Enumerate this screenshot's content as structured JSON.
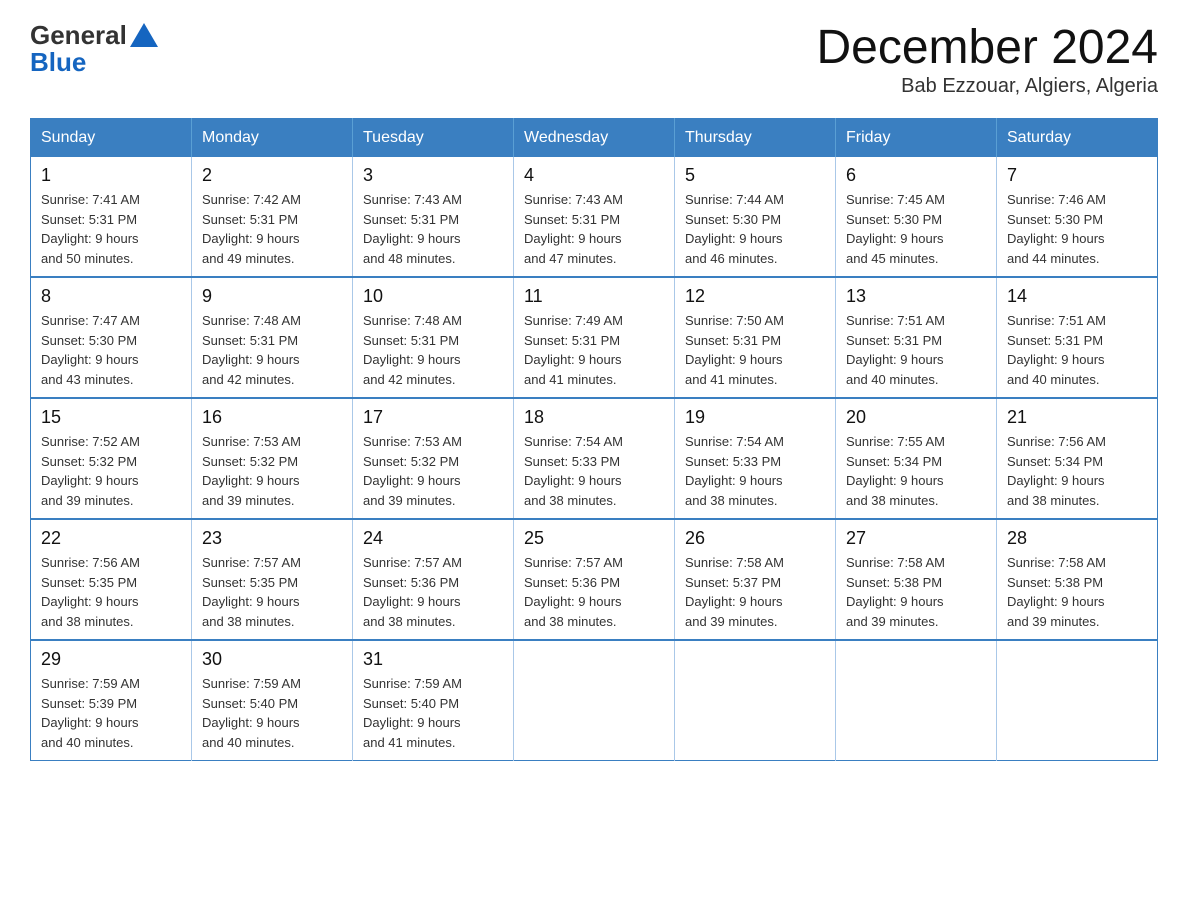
{
  "logo": {
    "general": "General",
    "blue": "Blue"
  },
  "title": "December 2024",
  "subtitle": "Bab Ezzouar, Algiers, Algeria",
  "days_of_week": [
    "Sunday",
    "Monday",
    "Tuesday",
    "Wednesday",
    "Thursday",
    "Friday",
    "Saturday"
  ],
  "weeks": [
    [
      {
        "day": "1",
        "sunrise": "7:41 AM",
        "sunset": "5:31 PM",
        "daylight": "9 hours and 50 minutes."
      },
      {
        "day": "2",
        "sunrise": "7:42 AM",
        "sunset": "5:31 PM",
        "daylight": "9 hours and 49 minutes."
      },
      {
        "day": "3",
        "sunrise": "7:43 AM",
        "sunset": "5:31 PM",
        "daylight": "9 hours and 48 minutes."
      },
      {
        "day": "4",
        "sunrise": "7:43 AM",
        "sunset": "5:31 PM",
        "daylight": "9 hours and 47 minutes."
      },
      {
        "day": "5",
        "sunrise": "7:44 AM",
        "sunset": "5:30 PM",
        "daylight": "9 hours and 46 minutes."
      },
      {
        "day": "6",
        "sunrise": "7:45 AM",
        "sunset": "5:30 PM",
        "daylight": "9 hours and 45 minutes."
      },
      {
        "day": "7",
        "sunrise": "7:46 AM",
        "sunset": "5:30 PM",
        "daylight": "9 hours and 44 minutes."
      }
    ],
    [
      {
        "day": "8",
        "sunrise": "7:47 AM",
        "sunset": "5:30 PM",
        "daylight": "9 hours and 43 minutes."
      },
      {
        "day": "9",
        "sunrise": "7:48 AM",
        "sunset": "5:31 PM",
        "daylight": "9 hours and 42 minutes."
      },
      {
        "day": "10",
        "sunrise": "7:48 AM",
        "sunset": "5:31 PM",
        "daylight": "9 hours and 42 minutes."
      },
      {
        "day": "11",
        "sunrise": "7:49 AM",
        "sunset": "5:31 PM",
        "daylight": "9 hours and 41 minutes."
      },
      {
        "day": "12",
        "sunrise": "7:50 AM",
        "sunset": "5:31 PM",
        "daylight": "9 hours and 41 minutes."
      },
      {
        "day": "13",
        "sunrise": "7:51 AM",
        "sunset": "5:31 PM",
        "daylight": "9 hours and 40 minutes."
      },
      {
        "day": "14",
        "sunrise": "7:51 AM",
        "sunset": "5:31 PM",
        "daylight": "9 hours and 40 minutes."
      }
    ],
    [
      {
        "day": "15",
        "sunrise": "7:52 AM",
        "sunset": "5:32 PM",
        "daylight": "9 hours and 39 minutes."
      },
      {
        "day": "16",
        "sunrise": "7:53 AM",
        "sunset": "5:32 PM",
        "daylight": "9 hours and 39 minutes."
      },
      {
        "day": "17",
        "sunrise": "7:53 AM",
        "sunset": "5:32 PM",
        "daylight": "9 hours and 39 minutes."
      },
      {
        "day": "18",
        "sunrise": "7:54 AM",
        "sunset": "5:33 PM",
        "daylight": "9 hours and 38 minutes."
      },
      {
        "day": "19",
        "sunrise": "7:54 AM",
        "sunset": "5:33 PM",
        "daylight": "9 hours and 38 minutes."
      },
      {
        "day": "20",
        "sunrise": "7:55 AM",
        "sunset": "5:34 PM",
        "daylight": "9 hours and 38 minutes."
      },
      {
        "day": "21",
        "sunrise": "7:56 AM",
        "sunset": "5:34 PM",
        "daylight": "9 hours and 38 minutes."
      }
    ],
    [
      {
        "day": "22",
        "sunrise": "7:56 AM",
        "sunset": "5:35 PM",
        "daylight": "9 hours and 38 minutes."
      },
      {
        "day": "23",
        "sunrise": "7:57 AM",
        "sunset": "5:35 PM",
        "daylight": "9 hours and 38 minutes."
      },
      {
        "day": "24",
        "sunrise": "7:57 AM",
        "sunset": "5:36 PM",
        "daylight": "9 hours and 38 minutes."
      },
      {
        "day": "25",
        "sunrise": "7:57 AM",
        "sunset": "5:36 PM",
        "daylight": "9 hours and 38 minutes."
      },
      {
        "day": "26",
        "sunrise": "7:58 AM",
        "sunset": "5:37 PM",
        "daylight": "9 hours and 39 minutes."
      },
      {
        "day": "27",
        "sunrise": "7:58 AM",
        "sunset": "5:38 PM",
        "daylight": "9 hours and 39 minutes."
      },
      {
        "day": "28",
        "sunrise": "7:58 AM",
        "sunset": "5:38 PM",
        "daylight": "9 hours and 39 minutes."
      }
    ],
    [
      {
        "day": "29",
        "sunrise": "7:59 AM",
        "sunset": "5:39 PM",
        "daylight": "9 hours and 40 minutes."
      },
      {
        "day": "30",
        "sunrise": "7:59 AM",
        "sunset": "5:40 PM",
        "daylight": "9 hours and 40 minutes."
      },
      {
        "day": "31",
        "sunrise": "7:59 AM",
        "sunset": "5:40 PM",
        "daylight": "9 hours and 41 minutes."
      },
      null,
      null,
      null,
      null
    ]
  ],
  "labels": {
    "sunrise": "Sunrise:",
    "sunset": "Sunset:",
    "daylight": "Daylight:"
  }
}
